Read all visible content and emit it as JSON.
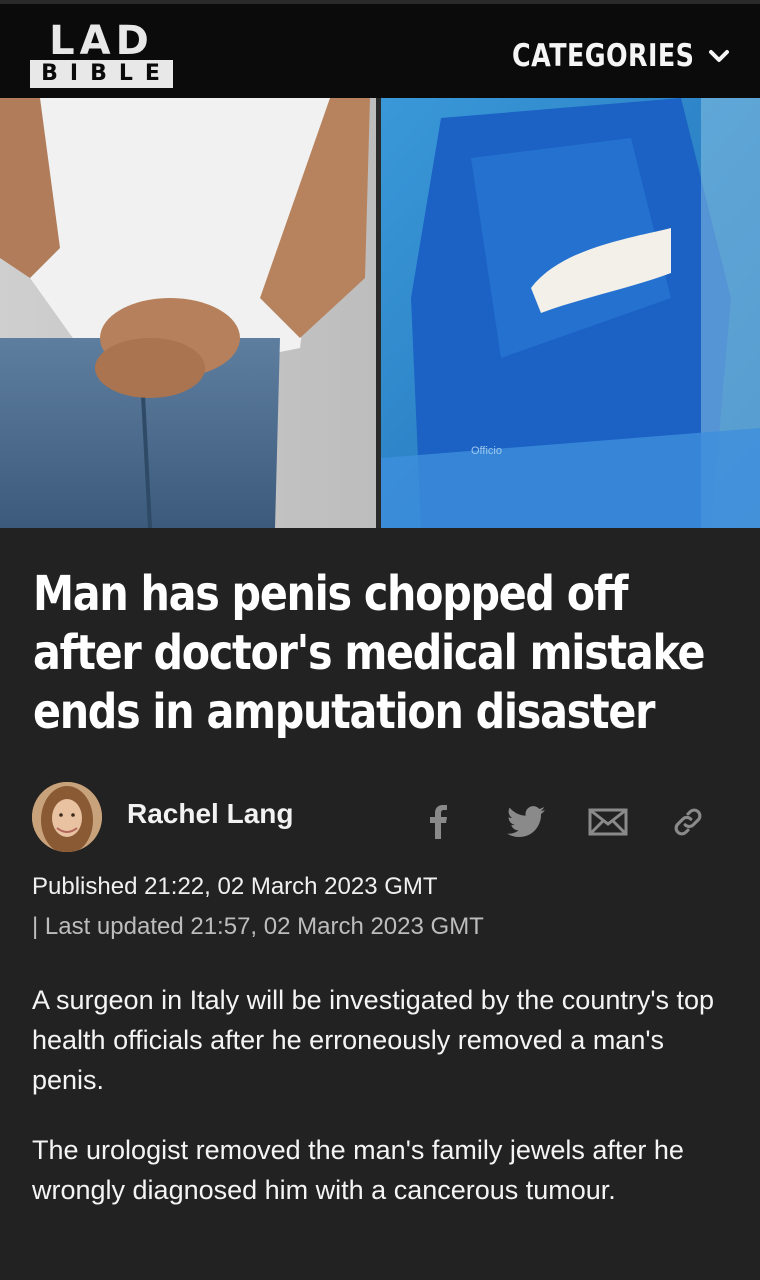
{
  "header": {
    "logo_top": "LAD",
    "logo_bottom": "BIBLE",
    "categories_label": "CATEGORIES"
  },
  "hero": {
    "watermark": "Officio"
  },
  "article": {
    "headline": "Man has penis chopped off after doctor's medical mistake ends in amputation disaster",
    "author": "Rachel Lang",
    "published": "Published 21:22, 02 March 2023 GMT",
    "updated": "| Last updated 21:57, 02 March 2023 GMT",
    "paragraphs": [
      "A surgeon in Italy will be investigated by the country's top health officials after he erroneously removed a man's penis.",
      "The urologist removed the man's family jewels after he wrongly diagnosed him with a cancerous tumour."
    ]
  },
  "share_icons": [
    "facebook-icon",
    "twitter-icon",
    "email-icon",
    "link-icon"
  ],
  "colors": {
    "header_bg": "#0b0b0b",
    "page_bg": "#222222",
    "text": "#ffffff",
    "meta_secondary": "#bdbdbd"
  }
}
